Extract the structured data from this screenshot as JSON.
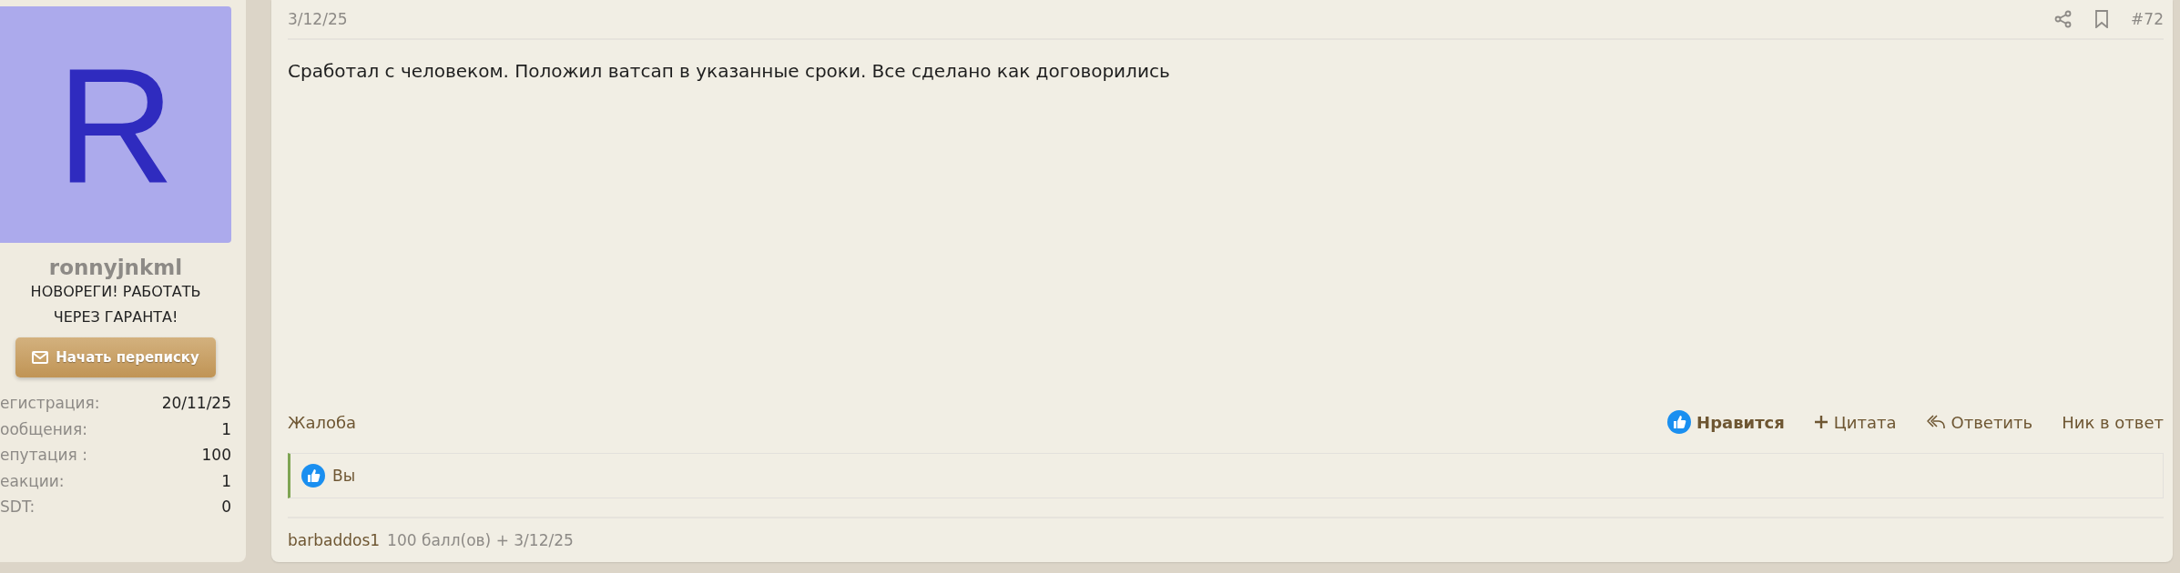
{
  "user": {
    "avatar_letter": "R",
    "name": "ronnyjnkml",
    "title": "НОВОРЕГИ! РАБОТАТЬ ЧЕРЕЗ ГАРАНТА!",
    "message_button": "Начать переписку",
    "stats": [
      {
        "label": "егистрация:",
        "value": "20/11/25"
      },
      {
        "label": "ообщения:",
        "value": "1"
      },
      {
        "label": "епутация :",
        "value": "100"
      },
      {
        "label": "еакции:",
        "value": "1"
      },
      {
        "label": "SDT:",
        "value": "0"
      }
    ]
  },
  "post": {
    "date": "3/12/25",
    "number": "#72",
    "body": "Сработал с человеком. Положил ватсап в указанные сроки. Все сделано как договорились",
    "report": "Жалоба",
    "actions": [
      {
        "kind": "like",
        "label": "Нравится",
        "selected": true
      },
      {
        "kind": "quote",
        "label": "Цитата"
      },
      {
        "kind": "reply",
        "label": "Ответить"
      },
      {
        "kind": "mention",
        "label": "Ник в ответ"
      }
    ],
    "reactions": "Вы",
    "rating": {
      "user": "barbaddos1",
      "details": "100 балл(ов) + 3/12/25"
    }
  }
}
